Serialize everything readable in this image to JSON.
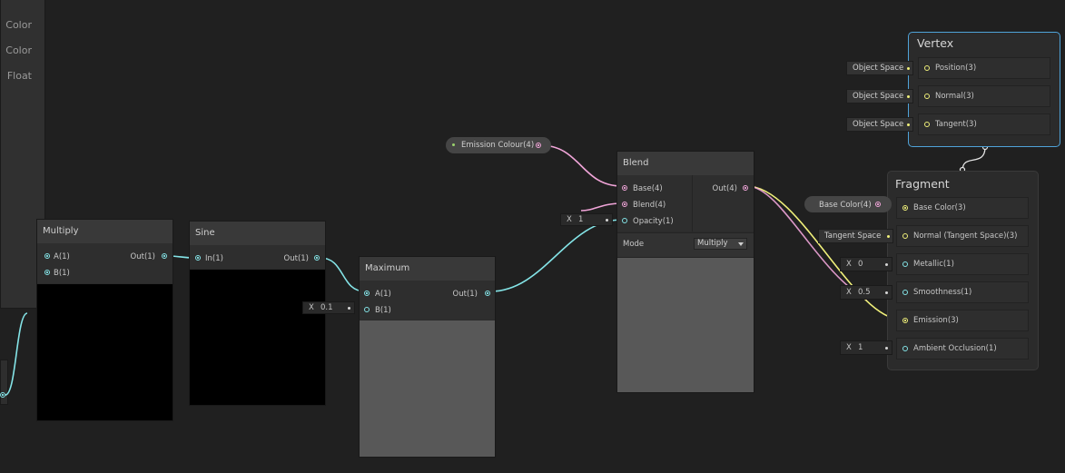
{
  "blackboard": {
    "items": [
      "Color",
      "Color",
      "Float"
    ]
  },
  "nodes": {
    "multiply": {
      "title": "Multiply",
      "inputs": [
        "A(1)",
        "B(1)"
      ],
      "output": "Out(1)"
    },
    "sine": {
      "title": "Sine",
      "inputs": [
        "In(1)"
      ],
      "output": "Out(1)"
    },
    "maximum": {
      "title": "Maximum",
      "inputs": [
        "A(1)",
        "B(1)"
      ],
      "output": "Out(1)",
      "b_axis": "X",
      "b_value": "0.1"
    },
    "blend": {
      "title": "Blend",
      "inputs": [
        "Base(4)",
        "Blend(4)",
        "Opacity(1)"
      ],
      "output": "Out(4)",
      "opacity_axis": "X",
      "opacity_value": "1",
      "mode_label": "Mode",
      "mode_value": "Multiply"
    }
  },
  "property_pills": {
    "emission_colour": "Emission Colour(4)",
    "base_color": "Base Color(4)"
  },
  "vertex": {
    "title": "Vertex",
    "slots": [
      {
        "label": "Position(3)",
        "input": "Object Space"
      },
      {
        "label": "Normal(3)",
        "input": "Object Space"
      },
      {
        "label": "Tangent(3)",
        "input": "Object Space"
      }
    ]
  },
  "fragment": {
    "title": "Fragment",
    "slots": [
      {
        "label": "Base Color(3)"
      },
      {
        "label": "Normal (Tangent Space)(3)",
        "input": "Tangent Space"
      },
      {
        "label": "Metallic(1)",
        "axis": "X",
        "value": "0"
      },
      {
        "label": "Smoothness(1)",
        "axis": "X",
        "value": "0.5"
      },
      {
        "label": "Emission(3)"
      },
      {
        "label": "Ambient Occlusion(1)",
        "axis": "X",
        "value": "1"
      }
    ]
  },
  "colors": {
    "background": "#202020",
    "wire_cyan": "#84e4e7",
    "wire_pink": "#f1a5d9",
    "wire_yellow": "#f0f07a",
    "context_highlight": "#4fa3d9",
    "annotation_red": "#e01818"
  }
}
